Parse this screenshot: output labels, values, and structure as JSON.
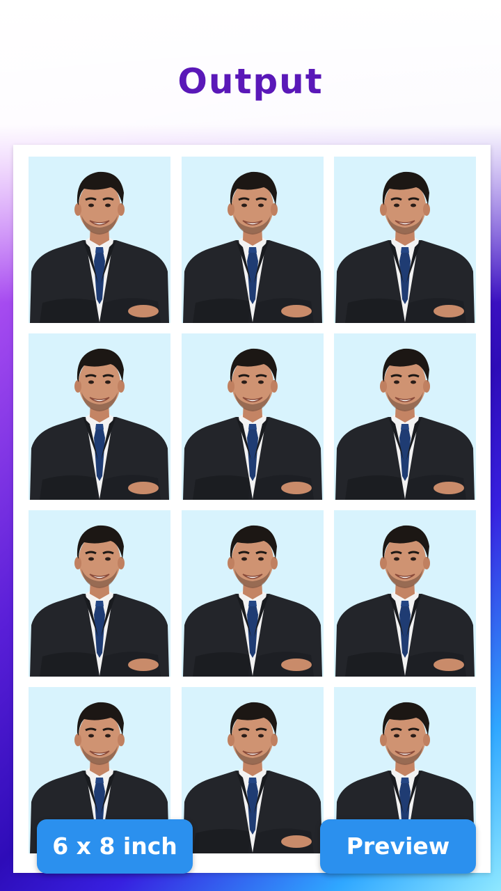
{
  "header": {
    "title": "Output"
  },
  "sheet": {
    "rows": 4,
    "columns": 3,
    "photo_background": "#d8f3fd"
  },
  "buttons": {
    "size_label": "6 x 8 inch",
    "preview_label": "Preview",
    "color": "#2b90ee"
  },
  "colors": {
    "title": "#5a18b8",
    "sheet": "#ffffff"
  }
}
